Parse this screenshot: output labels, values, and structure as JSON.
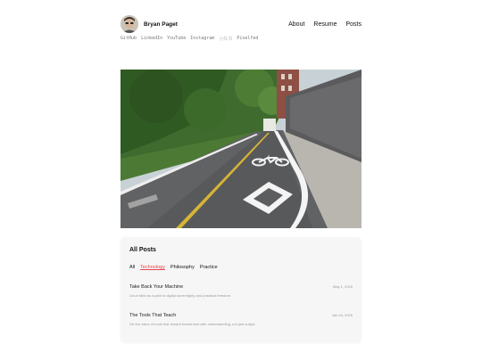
{
  "site": {
    "name": "Bryan Paget",
    "nav": [
      "About",
      "Resume",
      "Posts"
    ],
    "social": [
      "GitHub",
      "LinkedIn",
      "YouTube",
      "Instagram",
      "小红书",
      "Pixelfed"
    ]
  },
  "posts_section": {
    "title": "All Posts",
    "filters": [
      "All",
      "Technology",
      "Philosophy",
      "Practice"
    ],
    "active_filter": "Technology",
    "posts": [
      {
        "title": "Take Back Your Machine",
        "description": "Linux Mint as a path to digital sovereignty and practical freedom.",
        "date": "May 1, 2026"
      },
      {
        "title": "The Tools That Teach",
        "description": "On the value of tools that reward investment with understanding, not just output.",
        "date": "Jan 04, 2026"
      }
    ]
  },
  "colors": {
    "accent": "#e5484d",
    "card_background": "#f6f6f7",
    "text": "#111111",
    "muted": "#999999"
  },
  "icons": [
    "avatar-photo",
    "bicycle-lane-marking"
  ]
}
